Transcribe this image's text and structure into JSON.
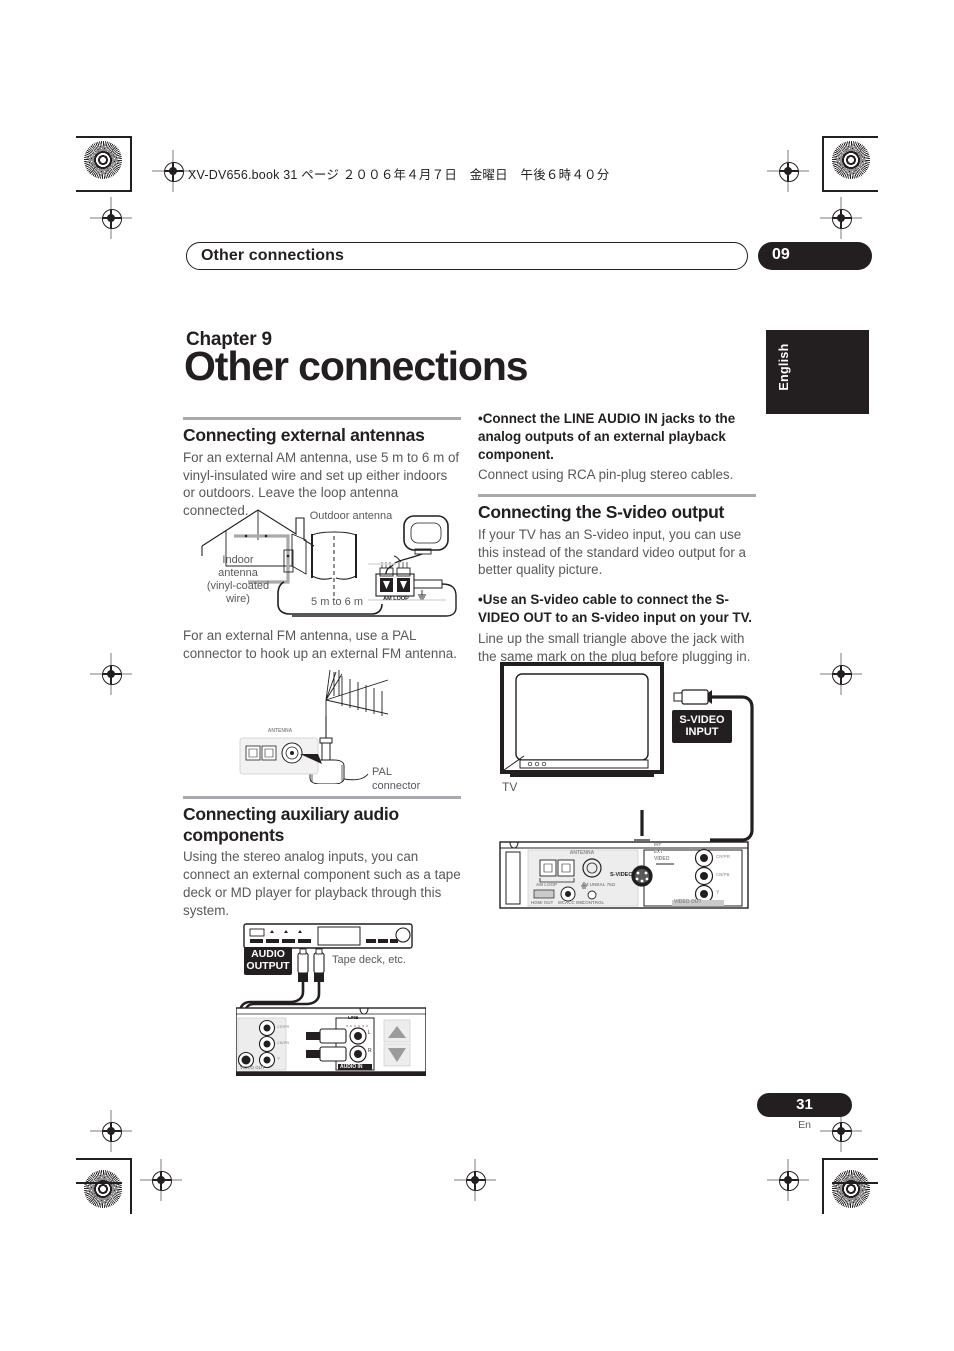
{
  "slug": {
    "text": "XV-DV656.book  31 ページ  ２００６年４月７日　金曜日　午後６時４０分"
  },
  "running_head": {
    "title": "Other connections",
    "chapter_number": "09"
  },
  "side_tab": {
    "label": "English"
  },
  "chapter": {
    "label": "Chapter 9",
    "title": "Other connections"
  },
  "left_column": {
    "section1": {
      "heading": "Connecting external antennas",
      "para1": "For an external AM antenna, use 5 m to 6 m of vinyl-insulated wire and set up either indoors or outdoors. Leave the loop antenna connected.",
      "figure": {
        "name": "am-antenna-diagram",
        "labels": {
          "outdoor": "Outdoor antenna",
          "indoor": "Indoor antenna\n(vinyl-coated wire)",
          "indoor_line1": "Indoor",
          "indoor_line2": "antenna",
          "indoor_line3": "(vinyl-coated",
          "indoor_line4": "wire)",
          "length": "5 m to 6 m",
          "amloop": "AM LOOP"
        }
      },
      "para2": "For an external FM antenna, use a PAL connector to hook up an external FM antenna.",
      "figure2": {
        "name": "fm-antenna-diagram",
        "labels": {
          "panel": "ANTENNA",
          "pal": "PAL connector"
        }
      }
    },
    "section2": {
      "heading": "Connecting auxiliary audio components",
      "para1": "Using the stereo analog inputs, you can connect an external component such as a tape deck or MD player for playback through this system.",
      "figure": {
        "name": "auxiliary-audio-diagram",
        "labels": {
          "audio_output_line1": "AUDIO",
          "audio_output_line2": "OUTPUT",
          "tape_deck": "Tape deck, etc.",
          "line": "LINE",
          "audio_in": "AUDIO IN",
          "ch_l": "L",
          "ch_r": "R",
          "video_out": "VIDEO  OUT",
          "y": "Y",
          "cb_pb": "CB/PB",
          "cr_pr": "CR/PR"
        }
      }
    }
  },
  "right_column": {
    "bullet1": {
      "bold": "Connect the LINE AUDIO IN jacks to the analog outputs of an external playback component.",
      "text": "Connect using RCA pin-plug stereo cables."
    },
    "section1": {
      "heading": "Connecting the S-video output",
      "para1": "If your TV has an S-video input, you can use this instead of the standard video output for a better quality picture.",
      "bullet": {
        "bold": "Use an S-video cable to connect the S-VIDEO OUT to an S-video input on your TV.",
        "text": "Line up the small triangle above the jack with the same mark on the plug before plugging in."
      },
      "figure": {
        "name": "s-video-diagram",
        "labels": {
          "tv": "TV",
          "s_video_input_line1": "S-VIDEO",
          "s_video_input_line2": "INPUT",
          "antenna": "ANTENNA",
          "am_loop": "AM LOOP",
          "fm_unbal": "FM UNBAL 75Ω",
          "hdmi_out": "HDMI OUT",
          "mcacc_mic": "MCACC MIC",
          "control": "CONTROL",
          "video": "VIDEO",
          "s_video": "S-VIDEO",
          "video_out": "VIDEO  OUT",
          "int": "INT",
          "ext": "EXT",
          "y": "Y",
          "cb_pb": "CB/PB",
          "cr_pr": "CR/PR"
        }
      }
    }
  },
  "footer": {
    "page_number": "31",
    "language": "En"
  },
  "colors": {
    "ink": "#231f20",
    "body_text": "#58595b",
    "rule": "#a7a9ac",
    "paper": "#ffffff"
  }
}
